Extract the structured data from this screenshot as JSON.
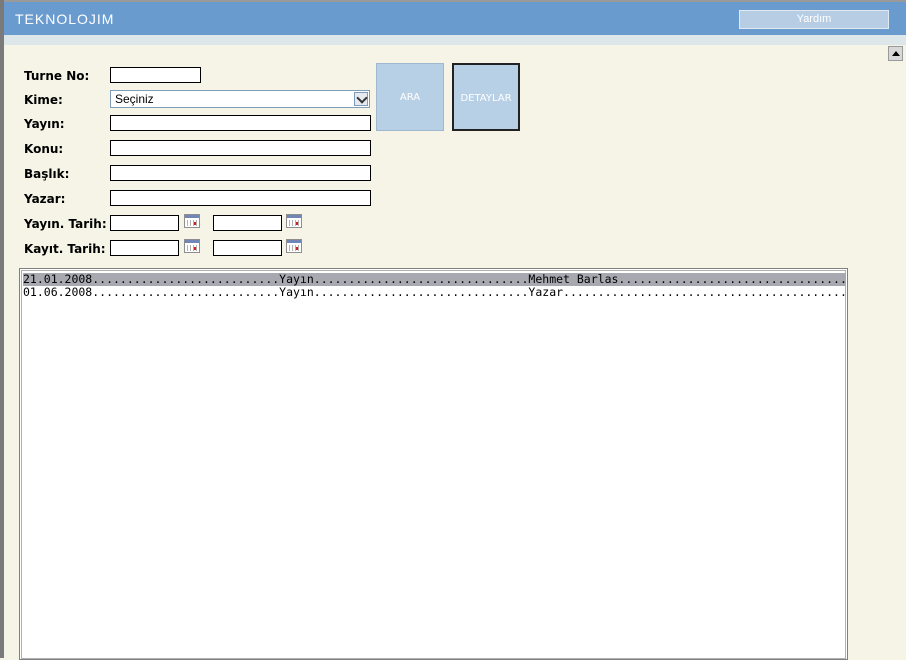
{
  "header": {
    "logo": "TEKNOLOJIM",
    "help_label": "Yardım"
  },
  "form": {
    "turne_label": "Turne No:",
    "kime_label": "Kime:",
    "kime_value": "Seçiniz",
    "yayin_label": "Yayın:",
    "konu_label": "Konu:",
    "baslik_label": "Başlık:",
    "yazar_label": "Yazar:",
    "yayin_tarih_label": "Yayın. Tarih:",
    "kayit_tarih_label": "Kayıt. Tarih:"
  },
  "buttons": {
    "ara": "ARA",
    "detaylar": "DETAYLAR"
  },
  "results": [
    {
      "text": "21.01.2008...........................Yayın...............................Mehmet Barlas.................................",
      "selected": true
    },
    {
      "text": "01.06.2008...........................Yayın...............................Yazar.........................................",
      "selected": false
    }
  ]
}
